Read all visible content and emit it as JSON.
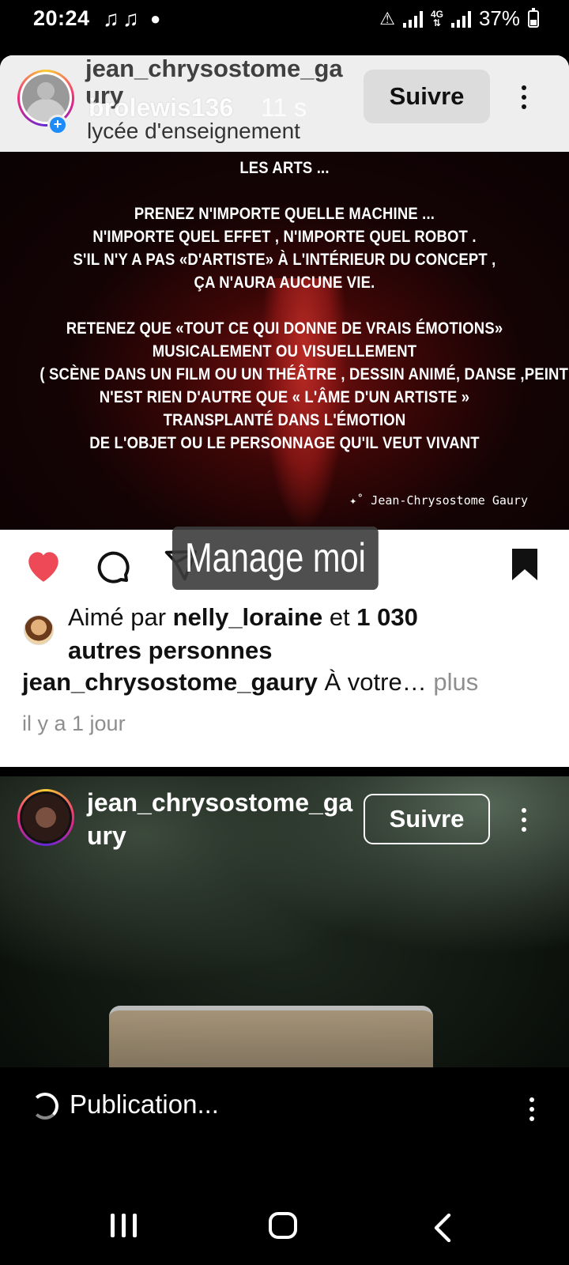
{
  "status_bar": {
    "time": "20:24",
    "battery": "37%",
    "network": "4G"
  },
  "post1": {
    "ghost_username_line1": "jean_chrysostome_ga",
    "ghost_username_line2": "ury",
    "overlay_username": "brolewis136",
    "overlay_time": "11 s",
    "subtitle": "lycée d'enseignement",
    "follow_label": "Suivre",
    "quote_lines": [
      "LES ARTS ...",
      "",
      "PRENEZ N'IMPORTE QUELLE MACHINE ...",
      "N'IMPORTE QUEL EFFET , N'IMPORTE QUEL ROBOT .",
      "S'IL N'Y A PAS «D'ARTISTE» À L'INTÉRIEUR DU CONCEPT ,",
      "ÇA N'AURA AUCUNE VIE.",
      "",
      "RETENEZ QUE «TOUT CE QUI DONNE DE VRAIS ÉMOTIONS»",
      "MUSICALEMENT OU  VISUELLEMENT",
      "( SCÈNE DANS UN FILM OU UN THÉÂTRE , DESSIN ANIMÉ, DANSE ,PEINTURE ETC )",
      "N'EST RIEN D'AUTRE QUE « L'ÂME D'UN ARTISTE »",
      "TRANSPLANTÉ DANS L'ÉMOTION",
      "DE L'OBJET OU LE PERSONNAGE QU'IL VEUT VIVANT"
    ],
    "signature": "✦˚ Jean-Chrysostome Gaury",
    "toast": "Manage moi",
    "liked_prefix": "Aimé par ",
    "liked_user": "nelly_loraine",
    "liked_middle": " et ",
    "liked_count": "1 030",
    "liked_suffix": "autres personnes",
    "caption_user": "jean_chrysostome_gaury",
    "caption_text": " À votre…",
    "caption_more": " plus",
    "date": "il y a 1 jour",
    "colors": {
      "like": "#ed4956",
      "follow_bg": "#dcdcdc"
    }
  },
  "post2": {
    "username_line1": "jean_chrysostome_ga",
    "username_line2": "ury",
    "follow_label": "Suivre"
  },
  "publishing": {
    "label": "Publication..."
  },
  "icons": [
    "heart-icon",
    "comment-icon",
    "share-icon",
    "bookmark-icon",
    "more-options-icon",
    "spinner-icon",
    "recent-apps-icon",
    "home-icon",
    "back-icon"
  ]
}
